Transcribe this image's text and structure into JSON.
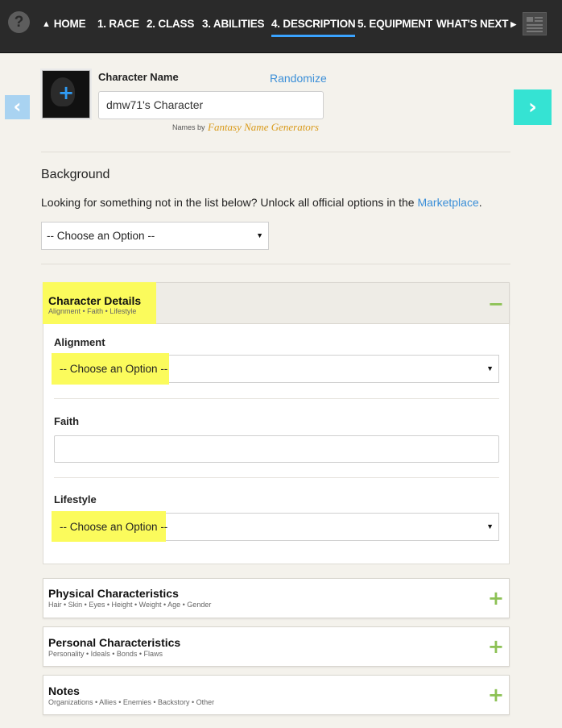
{
  "nav": {
    "help_icon": "?",
    "items": [
      {
        "label": "HOME",
        "icon": "home-icon"
      },
      {
        "label": "1. RACE"
      },
      {
        "label": "2. CLASS"
      },
      {
        "label": "3. ABILITIES"
      },
      {
        "label": "4. DESCRIPTION",
        "active": true
      },
      {
        "label": "5. EQUIPMENT"
      },
      {
        "label": "WHAT'S NEXT",
        "icon": "chevron-right-icon"
      }
    ],
    "sheet_icon": "character-sheet-icon"
  },
  "arrows": {
    "prev": "‹",
    "next": "›"
  },
  "character": {
    "name_label": "Character Name",
    "randomize_label": "Randomize",
    "name_value": "dmw71's Character",
    "names_by": "Names by",
    "names_by_source": "Fantasy Name Generators"
  },
  "background": {
    "title": "Background",
    "description_prefix": "Looking for something not in the list below? Unlock all official options in the ",
    "marketplace_link": "Marketplace",
    "description_suffix": ".",
    "select_value": "-- Choose an Option --"
  },
  "sections": {
    "details": {
      "title": "Character Details",
      "subtitle": "Alignment • Faith • Lifestyle",
      "toggle": "−",
      "alignment_label": "Alignment",
      "alignment_value": "-- Choose an Option --",
      "faith_label": "Faith",
      "faith_value": "",
      "lifestyle_label": "Lifestyle",
      "lifestyle_value": "-- Choose an Option --"
    },
    "physical": {
      "title": "Physical Characteristics",
      "subtitle": "Hair • Skin • Eyes • Height • Weight • Age • Gender",
      "toggle": "+"
    },
    "personal": {
      "title": "Personal Characteristics",
      "subtitle": "Personality • Ideals • Bonds • Flaws",
      "toggle": "+"
    },
    "notes": {
      "title": "Notes",
      "subtitle": "Organizations • Allies • Enemies • Backstory • Other",
      "toggle": "+"
    }
  },
  "colors": {
    "nav_bg": "#2a2a2a",
    "active_underline": "#3aa3ff",
    "link": "#3b8fd8",
    "next_arrow": "#35e3d3",
    "prev_arrow": "#a9d3f1",
    "highlight": "#fbfb5c",
    "toggle": "#8cc154"
  }
}
